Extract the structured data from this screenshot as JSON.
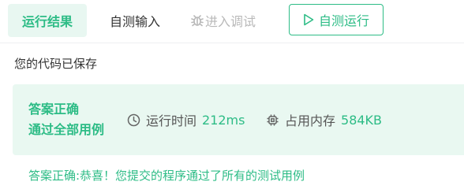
{
  "toolbar": {
    "tab_result": "运行结果",
    "tab_custom_input": "自测输入",
    "tab_debug": "进入调试",
    "run_button": "自测运行"
  },
  "status": {
    "saved": "您的代码已保存"
  },
  "result": {
    "verdict_line1": "答案正确",
    "verdict_line2": "通过全部用例",
    "time_label": "运行时间",
    "time_value": "212ms",
    "memory_label": "占用内存",
    "memory_value": "584KB"
  },
  "message": "答案正确:恭喜！您提交的程序通过了所有的测试用例",
  "colors": {
    "accent": "#2dbc86",
    "accent_bg": "#e9f8f1"
  },
  "icons": {
    "debug": "bug-icon",
    "run": "play-icon",
    "time": "clock-icon",
    "memory": "chip-icon"
  }
}
